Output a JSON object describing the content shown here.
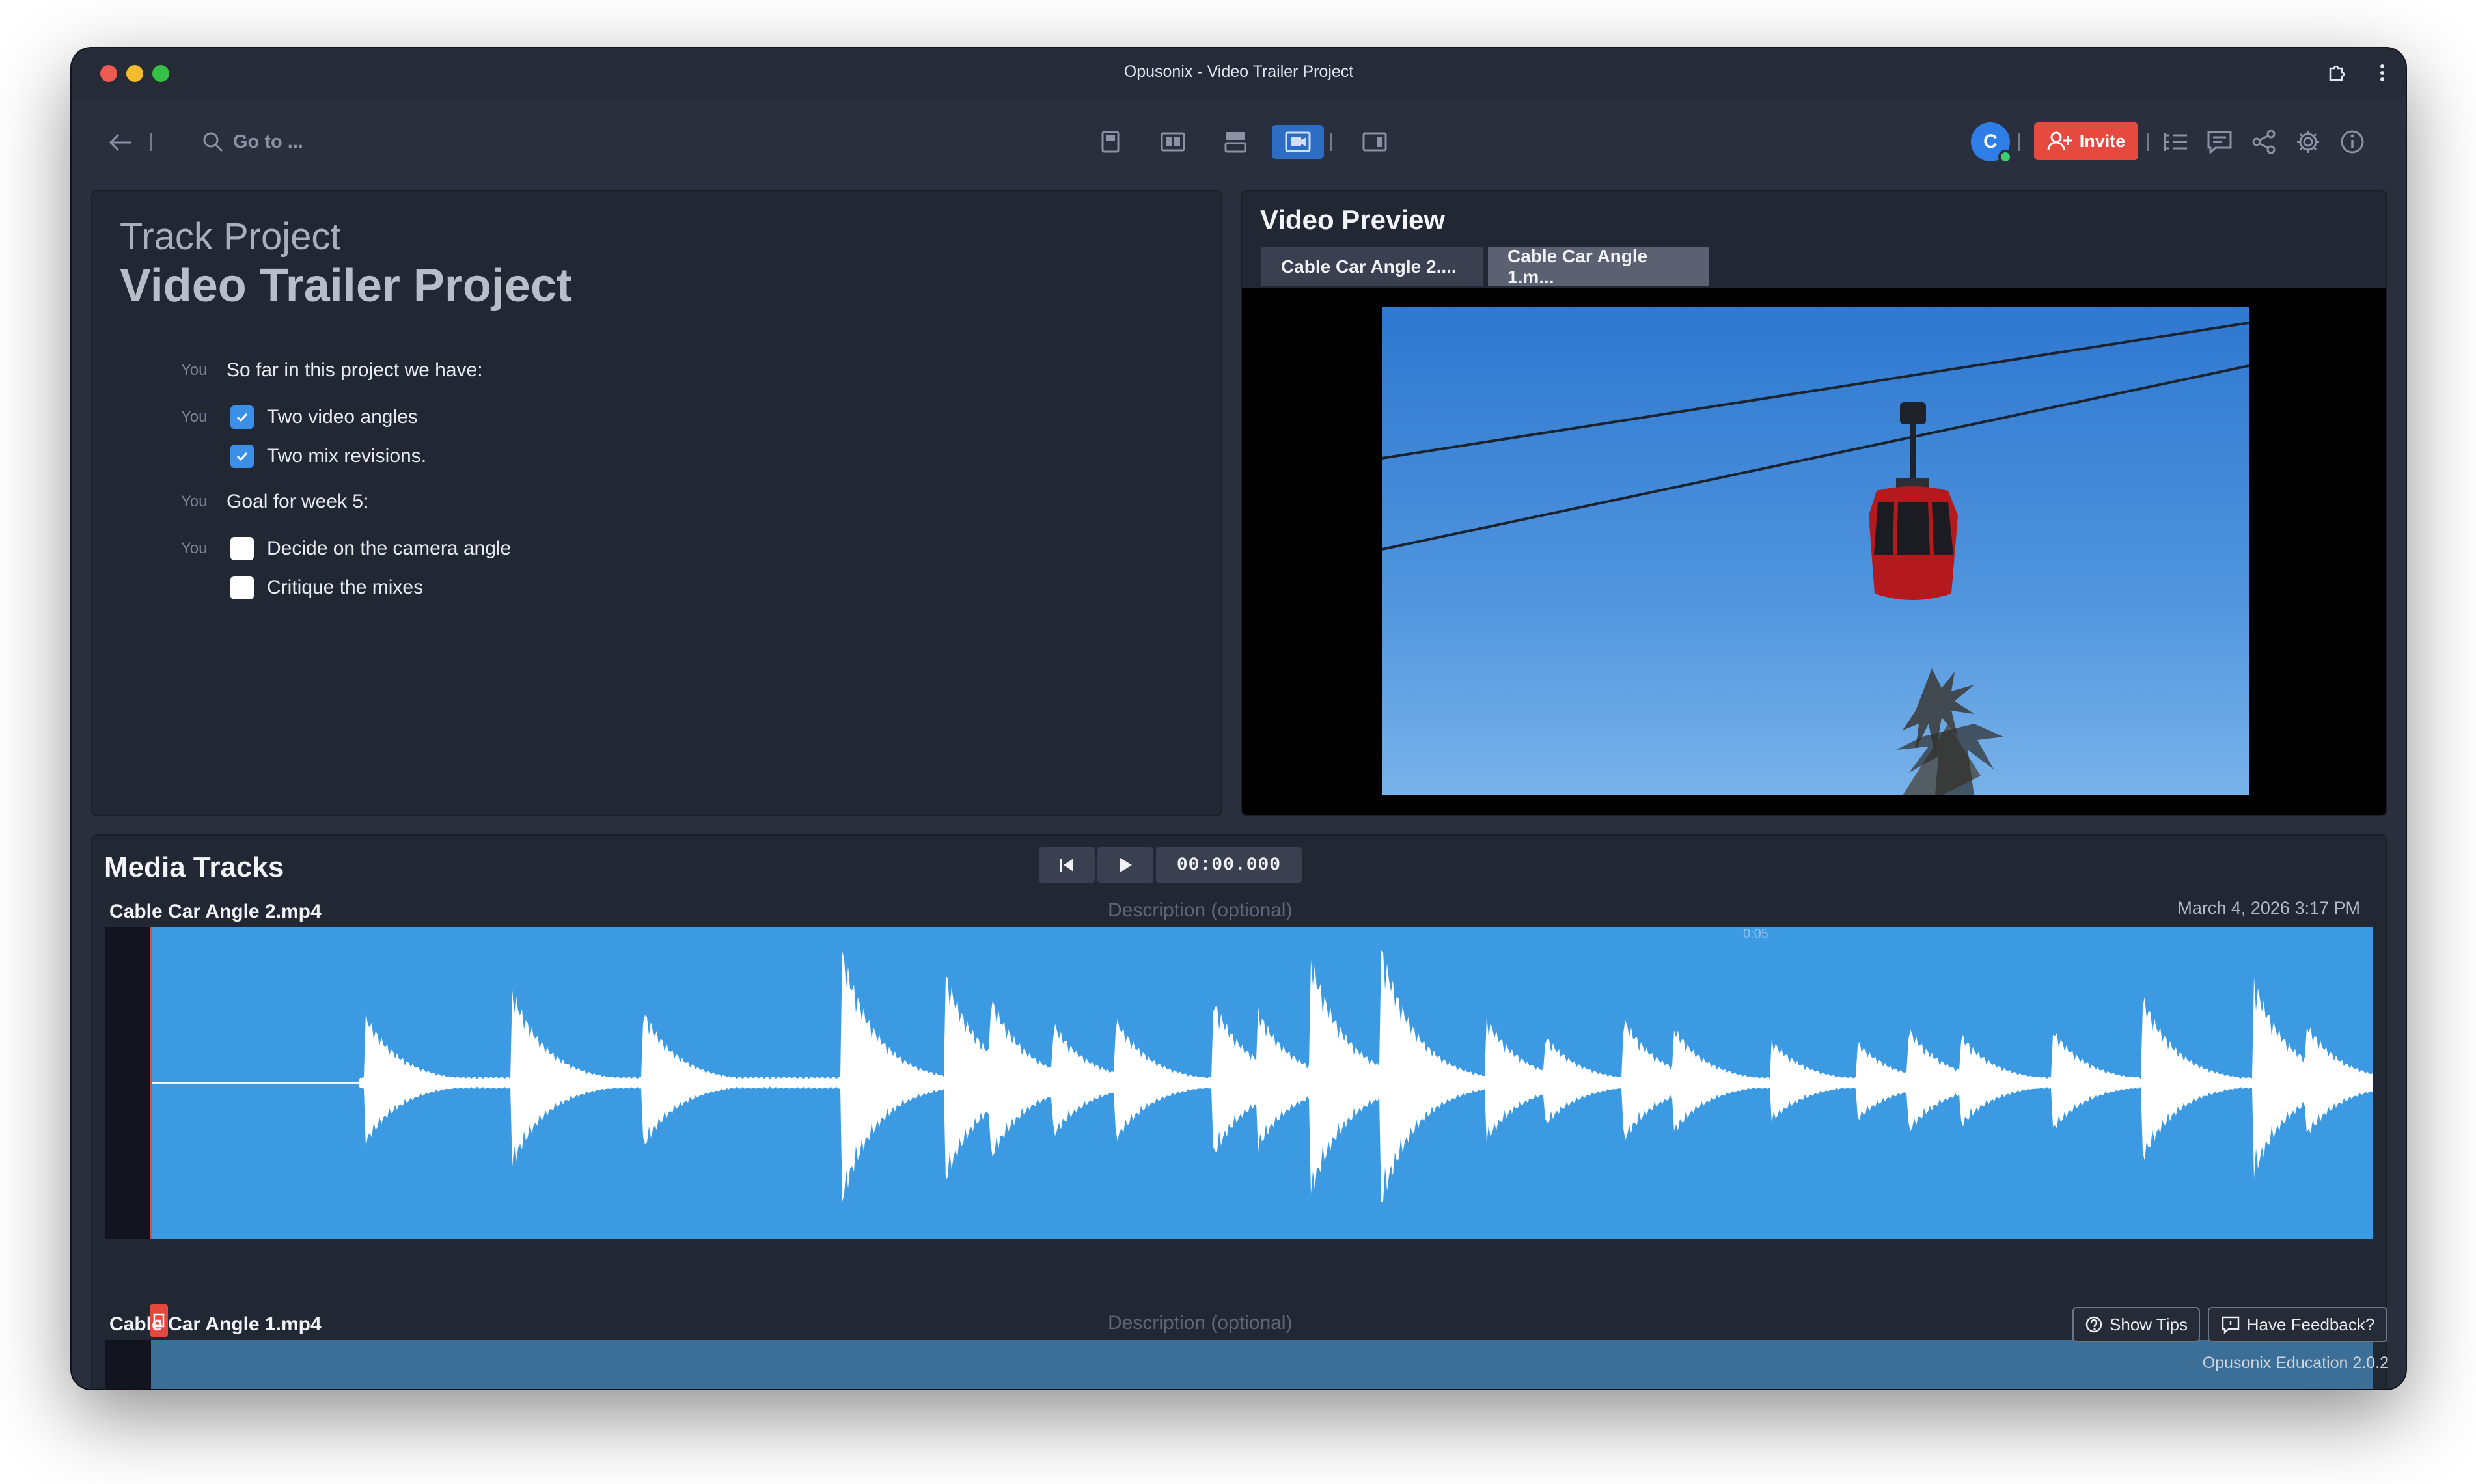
{
  "window": {
    "title": "Opusonix - Video Trailer Project"
  },
  "toolbar": {
    "goto_label": "Go to ...",
    "avatar_initial": "C",
    "invite_label": "Invite"
  },
  "track_project": {
    "label": "Track Project",
    "title": "Video Trailer Project",
    "notes": [
      {
        "author": "You",
        "text": "So far in this project we have:"
      },
      {
        "author": "You",
        "text": "Two video angles",
        "checked": true
      },
      {
        "author": "",
        "text": "Two mix revisions.",
        "checked": true
      },
      {
        "author": "You",
        "text": "Goal for week 5:"
      },
      {
        "author": "You",
        "text": "Decide on the camera angle",
        "checked": false
      },
      {
        "author": "",
        "text": "Critique the mixes",
        "checked": false
      }
    ]
  },
  "video_preview": {
    "title": "Video Preview",
    "tabs": [
      "Cable Car Angle 2....",
      "Cable Car Angle 1.m..."
    ],
    "active_tab": 1
  },
  "media_tracks": {
    "title": "Media Tracks",
    "timecode": "00:00.000",
    "tracks": [
      {
        "name": "Cable Car Angle 2.mp4",
        "description_placeholder": "Description (optional)",
        "date": "March 4, 2026 3:17 PM",
        "tick": "0:05"
      },
      {
        "name": "Cable Car Angle 1.mp4",
        "description_placeholder": "Description (optional)"
      }
    ]
  },
  "footer": {
    "show_tips": "Show Tips",
    "feedback": "Have Feedback?",
    "version": "Opusonix Education 2.0.2"
  },
  "colors": {
    "accent": "#2d6dc3",
    "invite": "#e64a3f",
    "waveform_bg": "#3b9ae2",
    "playhead": "#e4483c"
  }
}
